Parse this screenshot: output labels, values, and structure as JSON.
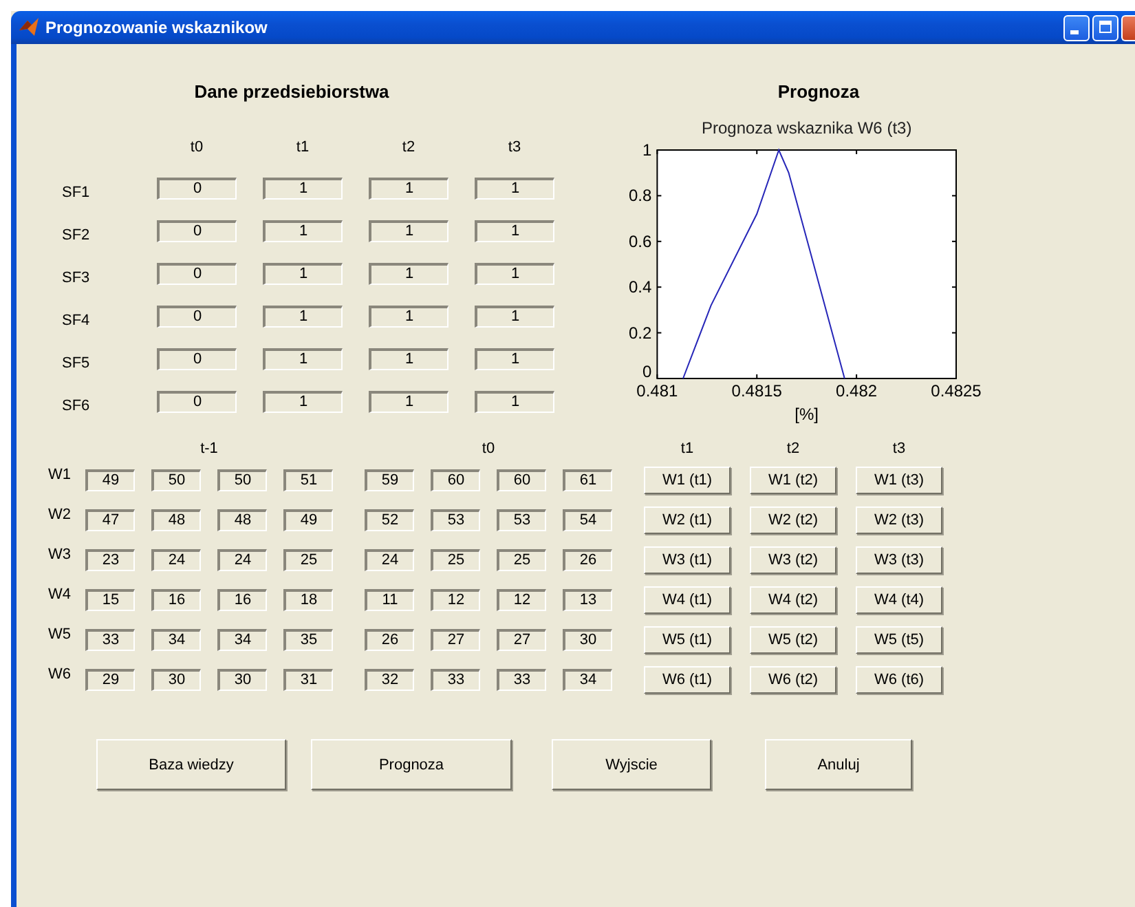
{
  "window": {
    "title": "Prognozowanie wskaznikow"
  },
  "company_data": {
    "title": "Dane przedsiebiorstwa",
    "columns": [
      "t0",
      "t1",
      "t2",
      "t3"
    ],
    "rows": [
      {
        "label": "SF1",
        "values": [
          "0",
          "1",
          "1",
          "1"
        ]
      },
      {
        "label": "SF2",
        "values": [
          "0",
          "1",
          "1",
          "1"
        ]
      },
      {
        "label": "SF3",
        "values": [
          "0",
          "1",
          "1",
          "1"
        ]
      },
      {
        "label": "SF4",
        "values": [
          "0",
          "1",
          "1",
          "1"
        ]
      },
      {
        "label": "SF5",
        "values": [
          "0",
          "1",
          "1",
          "1"
        ]
      },
      {
        "label": "SF6",
        "values": [
          "0",
          "1",
          "1",
          "1"
        ]
      }
    ]
  },
  "forecast": {
    "title": "Prognoza",
    "chart_data": {
      "type": "line",
      "title": "Prognoza wskaznika W6 (t3)",
      "xlabel": "[%]",
      "xlim": [
        0.481,
        0.4825
      ],
      "ylim": [
        0,
        1
      ],
      "xticks": [
        0.481,
        0.4815,
        0.482,
        0.4825
      ],
      "yticks": [
        0,
        0.2,
        0.4,
        0.6,
        0.8,
        1
      ],
      "x": [
        0.48113,
        0.48127,
        0.4815,
        0.48161,
        0.48166,
        0.48176,
        0.48194
      ],
      "series": [
        {
          "color": "#2626b8",
          "values": [
            0,
            0.32,
            0.72,
            1,
            0.9,
            0.58,
            0
          ]
        }
      ]
    }
  },
  "indicators": {
    "group_headers": [
      "t-1",
      "t0"
    ],
    "button_headers": [
      "t1",
      "t2",
      "t3"
    ],
    "rows": [
      {
        "label": "W1",
        "values": [
          "49",
          "50",
          "50",
          "51",
          "59",
          "60",
          "60",
          "61"
        ],
        "buttons": [
          "W1 (t1)",
          "W1 (t2)",
          "W1 (t3)"
        ]
      },
      {
        "label": "W2",
        "values": [
          "47",
          "48",
          "48",
          "49",
          "52",
          "53",
          "53",
          "54"
        ],
        "buttons": [
          "W2 (t1)",
          "W2 (t2)",
          "W2 (t3)"
        ]
      },
      {
        "label": "W3",
        "values": [
          "23",
          "24",
          "24",
          "25",
          "24",
          "25",
          "25",
          "26"
        ],
        "buttons": [
          "W3 (t1)",
          "W3 (t2)",
          "W3 (t3)"
        ]
      },
      {
        "label": "W4",
        "values": [
          "15",
          "16",
          "16",
          "18",
          "11",
          "12",
          "12",
          "13"
        ],
        "buttons": [
          "W4 (t1)",
          "W4 (t2)",
          "W4 (t4)"
        ]
      },
      {
        "label": "W5",
        "values": [
          "33",
          "34",
          "34",
          "35",
          "26",
          "27",
          "27",
          "30"
        ],
        "buttons": [
          "W5 (t1)",
          "W5 (t2)",
          "W5 (t5)"
        ]
      },
      {
        "label": "W6",
        "values": [
          "29",
          "30",
          "30",
          "31",
          "32",
          "33",
          "33",
          "34"
        ],
        "buttons": [
          "W6 (t1)",
          "W6 (t2)",
          "W6 (t6)"
        ]
      }
    ]
  },
  "actions": [
    "Baza wiedzy",
    "Prognoza",
    "Wyjscie",
    "Anuluj"
  ]
}
